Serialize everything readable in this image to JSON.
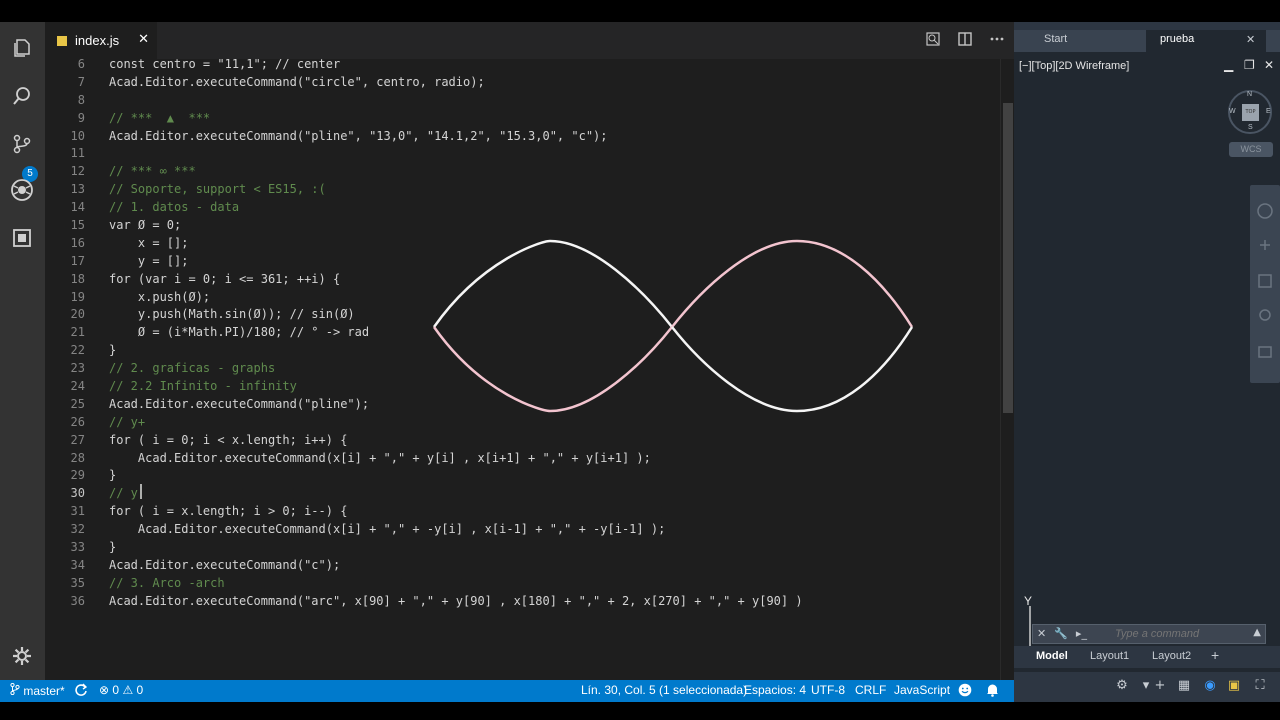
{
  "vscode": {
    "tab": {
      "filename": "index.js",
      "close": "✕"
    },
    "activity": {
      "scm_badge": "5"
    },
    "code_lines": [
      {
        "n": "6",
        "text": "const centro = \"11,1\"; // center",
        "type": "code"
      },
      {
        "n": "7",
        "text": "Acad.Editor.executeCommand(\"circle\", centro, radio);",
        "type": "code"
      },
      {
        "n": "8",
        "text": "",
        "type": "code"
      },
      {
        "n": "9",
        "text": "// ***  ▲  ***",
        "type": "comment"
      },
      {
        "n": "10",
        "text": "Acad.Editor.executeCommand(\"pline\", \"13,0\", \"14.1,2\", \"15.3,0\", \"c\");",
        "type": "code"
      },
      {
        "n": "11",
        "text": "",
        "type": "code"
      },
      {
        "n": "12",
        "text": "// *** ∞ ***",
        "type": "comment"
      },
      {
        "n": "13",
        "text": "// Soporte, support < ES15, :(",
        "type": "comment"
      },
      {
        "n": "14",
        "text": "// 1. datos - data",
        "type": "comment"
      },
      {
        "n": "15",
        "text": "var Ø = 0;",
        "type": "code"
      },
      {
        "n": "16",
        "text": "    x = [];",
        "type": "code"
      },
      {
        "n": "17",
        "text": "    y = [];",
        "type": "code"
      },
      {
        "n": "18",
        "text": "for (var i = 0; i <= 361; ++i) {",
        "type": "code"
      },
      {
        "n": "19",
        "text": "    x.push(Ø);",
        "type": "code"
      },
      {
        "n": "20",
        "text": "    y.push(Math.sin(Ø)); // sin(Ø)",
        "type": "code"
      },
      {
        "n": "21",
        "text": "    Ø = (i*Math.PI)/180; // ° -> rad",
        "type": "code"
      },
      {
        "n": "22",
        "text": "}",
        "type": "code"
      },
      {
        "n": "23",
        "text": "// 2. graficas - graphs",
        "type": "comment"
      },
      {
        "n": "24",
        "text": "// 2.2 Infinito - infinity",
        "type": "comment"
      },
      {
        "n": "25",
        "text": "Acad.Editor.executeCommand(\"pline\");",
        "type": "code"
      },
      {
        "n": "26",
        "text": "// y+",
        "type": "comment"
      },
      {
        "n": "27",
        "text": "for ( i = 0; i < x.length; i++) {",
        "type": "code"
      },
      {
        "n": "28",
        "text": "    Acad.Editor.executeCommand(x[i] + \",\" + y[i] , x[i+1] + \",\" + y[i+1] );",
        "type": "code"
      },
      {
        "n": "29",
        "text": "}",
        "type": "code"
      },
      {
        "n": "30",
        "text": "// y",
        "type": "comment",
        "current": true
      },
      {
        "n": "31",
        "text": "for ( i = x.length; i > 0; i--) {",
        "type": "code"
      },
      {
        "n": "32",
        "text": "    Acad.Editor.executeCommand(x[i] + \",\" + -y[i] , x[i-1] + \",\" + -y[i-1] );",
        "type": "code"
      },
      {
        "n": "33",
        "text": "}",
        "type": "code"
      },
      {
        "n": "34",
        "text": "Acad.Editor.executeCommand(\"c\");",
        "type": "code"
      },
      {
        "n": "35",
        "text": "// 3. Arco -arch",
        "type": "comment"
      },
      {
        "n": "36",
        "text": "Acad.Editor.executeCommand(\"arc\", x[90] + \",\" + y[90] , x[180] + \",\" + 2, x[270] + \",\" + y[90] )",
        "type": "code"
      }
    ],
    "status": {
      "branch": "master*",
      "errors": "0",
      "warnings": "0",
      "position": "Lín. 30, Col. 5 (1 seleccionada)",
      "spaces": "Espacios: 4",
      "encoding": "UTF-8",
      "eol": "CRLF",
      "language": "JavaScript"
    }
  },
  "autocad": {
    "tabs": {
      "start": "Start",
      "active": "prueba",
      "close": "✕"
    },
    "viewport_label": "[−][Top][2D Wireframe]",
    "viewcube": {
      "n": "N",
      "s": "S",
      "w": "W",
      "e": "E",
      "top": "TOP"
    },
    "wcs": "WCS",
    "ucs_y": "Y",
    "command_placeholder": "Type a command",
    "layout_tabs": [
      "Model",
      "Layout1",
      "Layout2"
    ],
    "add_layout": "+"
  },
  "colors": {
    "statusbar": "#007acc",
    "curve_upper_left": "#f5f5f5",
    "curve_pink": "#f3c4cf",
    "comment": "#608b4e"
  }
}
